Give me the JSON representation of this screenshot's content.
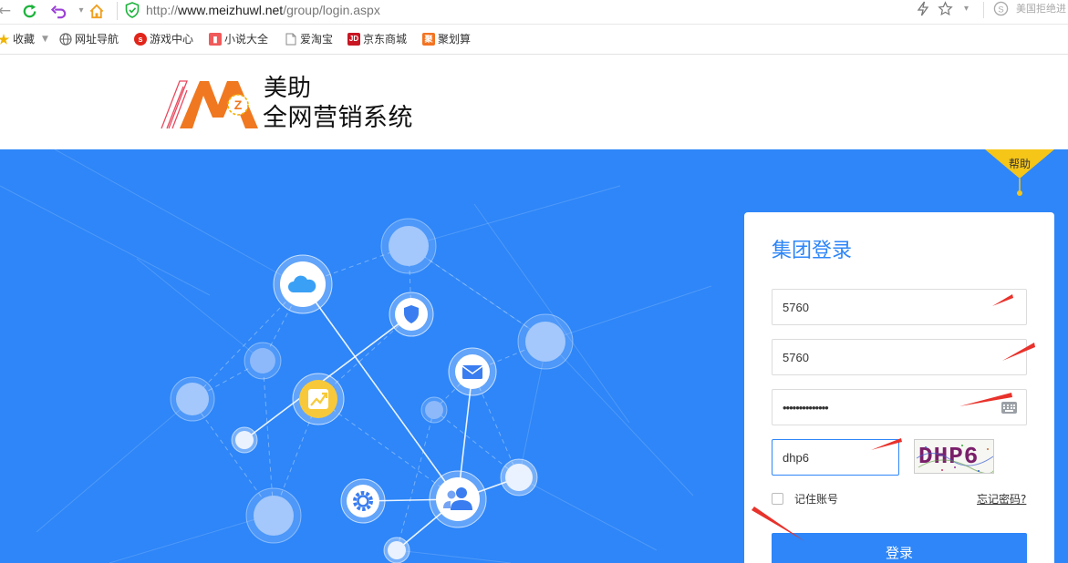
{
  "browser": {
    "url_prefix": "http://",
    "url_host": "www.meizhuwl.net",
    "url_path": "/group/login.aspx",
    "right_text": "美国拒绝进"
  },
  "bookmarks": [
    {
      "label": "收藏",
      "icon": "star-icon"
    },
    {
      "label": "网址导航",
      "icon": "globe-icon"
    },
    {
      "label": "游戏中心",
      "icon": "game-icon"
    },
    {
      "label": "小说大全",
      "icon": "book-icon"
    },
    {
      "label": "爱淘宝",
      "icon": "page-icon"
    },
    {
      "label": "京东商城",
      "icon": "jd-icon",
      "badge": "JD"
    },
    {
      "label": "聚划算",
      "icon": "juhuasuan-icon",
      "badge": "聚"
    }
  ],
  "header": {
    "brand_line1": "美助",
    "brand_line2": "全网营销系统"
  },
  "help": {
    "label": "帮助"
  },
  "login": {
    "title": "集团登录",
    "group_id": "5760",
    "username": "5760",
    "password": "••••••••••••••",
    "captcha_input": "dhp6",
    "captcha_text": "DHP6",
    "remember_label": "记住账号",
    "forgot_label": "忘记密码?",
    "submit_label": "登录"
  },
  "colors": {
    "primary": "#2e86f8",
    "help_ribbon": "#f5c518",
    "annotation_arrow": "#e8322b",
    "logo_orange": "#f07820"
  }
}
